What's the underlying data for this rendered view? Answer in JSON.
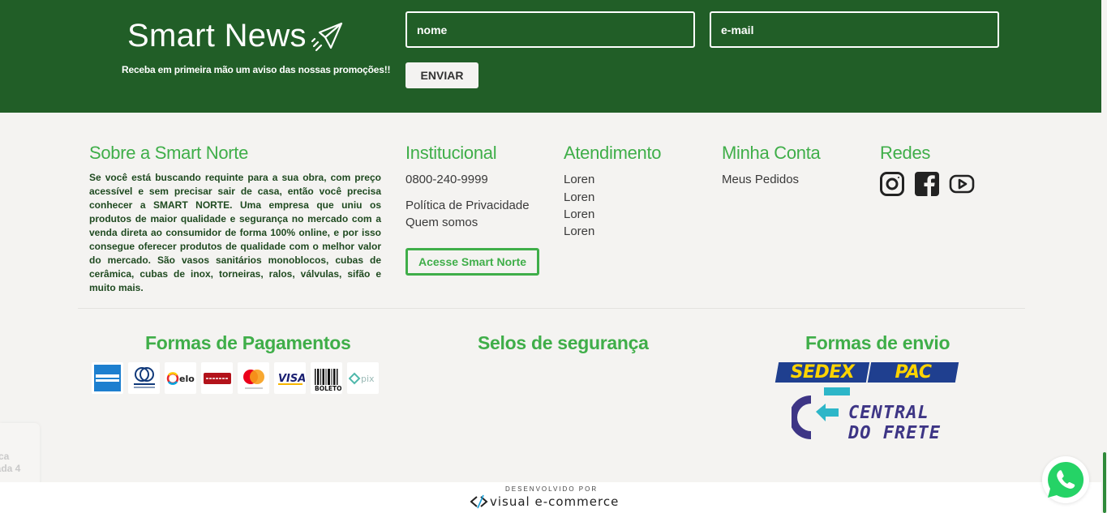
{
  "newsletter": {
    "title": "Smart News",
    "subtitle": "Receba em primeira mão um aviso das nossas promoções!!",
    "name_placeholder": "nome",
    "email_placeholder": "e-mail",
    "send_label": "ENVIAR"
  },
  "about": {
    "title": "Sobre a Smart Norte",
    "text": "Se você está buscando requinte para a sua obra, com preço acessível e sem precisar sair de casa, então você precisa conhecer a SMART NORTE. Uma empresa que uniu os produtos de maior qualidade e segurança no mercado com a venda direta ao consumidor de forma 100% online, e por isso consegue oferecer produtos de qualidade com o melhor valor do mercado. São vasos sanitários monoblocos, cubas de cerâmica, cubas de inox, torneiras, ralos, válvulas, sifão e muito mais."
  },
  "institucional": {
    "title": "Institucional",
    "phone": "0800-240-9999",
    "links": [
      "Política de Privacidade",
      "Quem somos"
    ],
    "cta_label": "Acesse Smart Norte"
  },
  "atendimento": {
    "title": "Atendimento",
    "links": [
      "Loren",
      "Loren",
      "Loren",
      "Loren"
    ]
  },
  "minha_conta": {
    "title": "Minha Conta",
    "links": [
      "Meus Pedidos"
    ]
  },
  "redes": {
    "title": "Redes",
    "icons": [
      "instagram-icon",
      "facebook-icon",
      "youtube-icon"
    ]
  },
  "pagamentos": {
    "title": "Formas de Pagamentos",
    "cards": [
      "amex",
      "diners",
      "elo",
      "hipercard",
      "mastercard",
      "visa",
      "boleto",
      "pix"
    ],
    "visa_text": "VISA",
    "elo_text": "elo",
    "boleto_text": "BOLETO",
    "pix_text": "pix"
  },
  "seguranca": {
    "title": "Selos de segurança"
  },
  "envio": {
    "title": "Formas de envio",
    "sedex": "SEDEX",
    "pac": "PAC",
    "frete_line1": "CENTRAL",
    "frete_line2": "DO FRETE"
  },
  "side_widget": {
    "line1": "ca",
    "line2": "rada 4"
  },
  "credits": {
    "label": "DESENVOLVIDO POR",
    "brand": "visual e-commerce"
  },
  "colors": {
    "brand_green": "#215e27",
    "accent_green": "#3fae49",
    "background": "#f4f3f1"
  }
}
